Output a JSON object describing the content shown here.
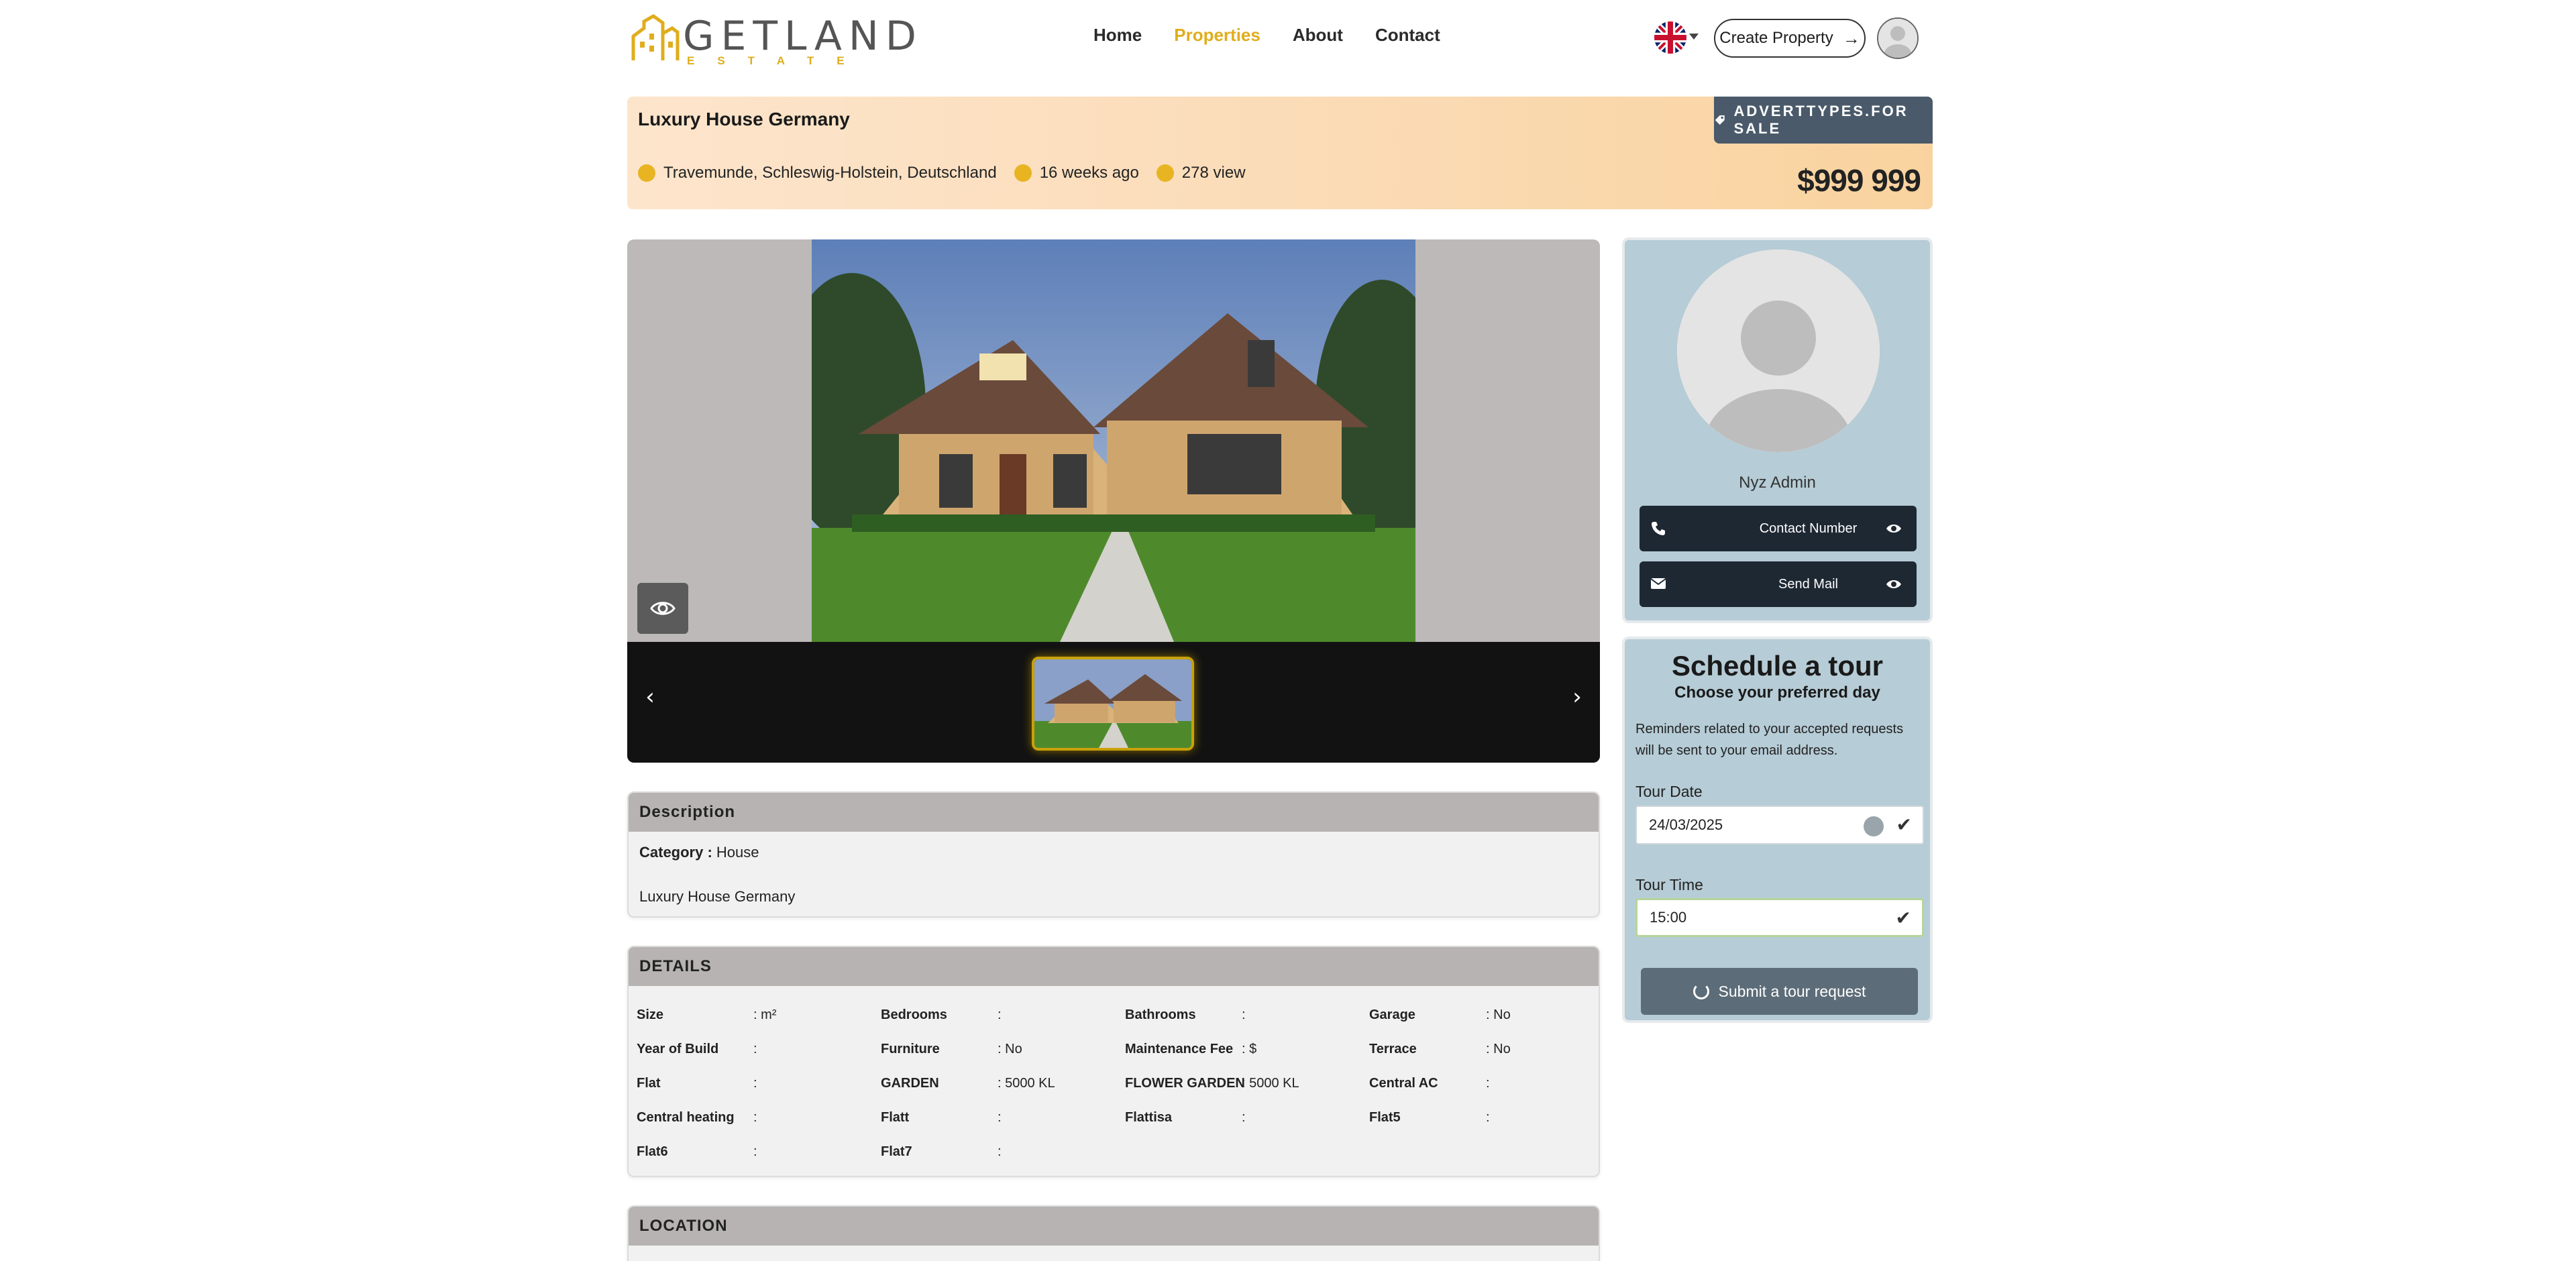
{
  "nav": {
    "logo_word": "GETLAND",
    "logo_sub": "ESTATE",
    "links": [
      "Home",
      "Properties",
      "About",
      "Contact"
    ],
    "active_index": 1,
    "create_label": "Create Property",
    "accent_color": "#e0ad1c"
  },
  "listing": {
    "title": "Luxury House Germany",
    "badge": "ADVERTTYPES.FOR SALE",
    "location": "Travemunde, Schleswig-Holstein, Deutschland",
    "posted": "16 weeks ago",
    "views": "278 view",
    "price": "$999 999"
  },
  "description": {
    "heading": "Description",
    "category_label": "Category :",
    "category_value": "House",
    "text": "Luxury House Germany"
  },
  "details": {
    "heading": "DETAILS",
    "rows": [
      [
        {
          "label": "Size",
          "value": "m²"
        },
        {
          "label": "Bedrooms",
          "value": ""
        },
        {
          "label": "Bathrooms",
          "value": ""
        },
        {
          "label": "Garage",
          "value": "No"
        }
      ],
      [
        {
          "label": "Year of Build",
          "value": ""
        },
        {
          "label": "Furniture",
          "value": "No"
        },
        {
          "label": "Maintenance Fee",
          "value": "$"
        },
        {
          "label": "Terrace",
          "value": "No"
        }
      ],
      [
        {
          "label": "Flat",
          "value": ""
        },
        {
          "label": "GARDEN",
          "value": "5000 KL"
        },
        {
          "label": "FLOWER GARDEN",
          "value": "5000 KL"
        },
        {
          "label": "Central AC",
          "value": ""
        }
      ],
      [
        {
          "label": "Central heating",
          "value": ""
        },
        {
          "label": "Flatt",
          "value": ""
        },
        {
          "label": "Flattisa",
          "value": ""
        },
        {
          "label": "Flat5",
          "value": ""
        }
      ],
      [
        {
          "label": "Flat6",
          "value": ""
        },
        {
          "label": "Flat7",
          "value": ""
        }
      ]
    ]
  },
  "location": {
    "heading": "LOCATION"
  },
  "agent": {
    "name": "Nyz Admin",
    "contact_label": "Contact Number",
    "mail_label": "Send Mail"
  },
  "tour": {
    "title": "Schedule a tour",
    "subtitle": "Choose your preferred day",
    "note": "Reminders related to your accepted requests will be sent to your email address.",
    "date_label": "Tour Date",
    "date_value": "24/03/2025",
    "time_label": "Tour Time",
    "time_value": "15:00",
    "submit_label": "Submit a tour request"
  }
}
